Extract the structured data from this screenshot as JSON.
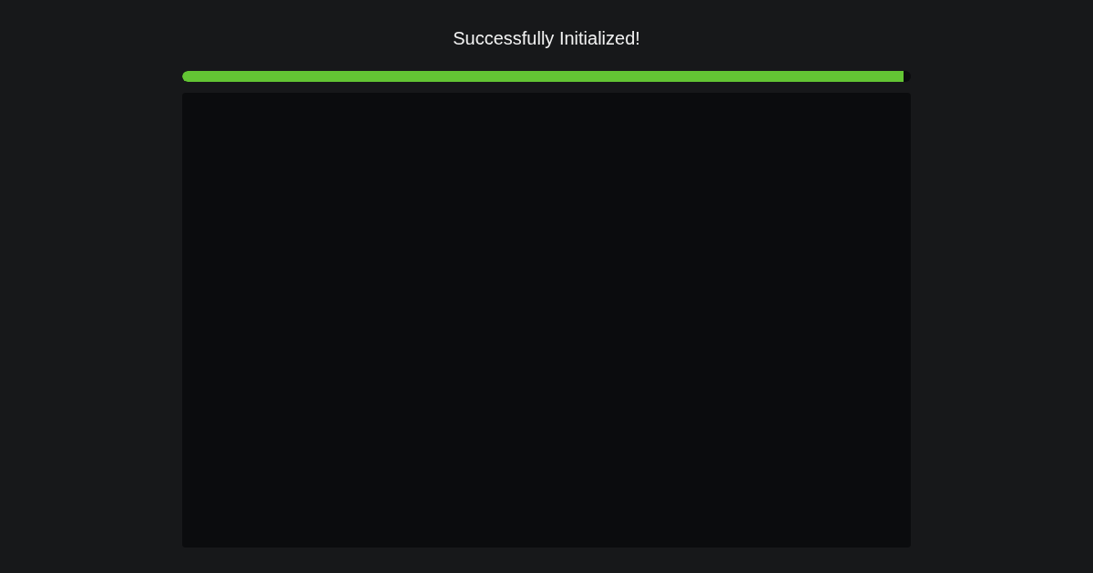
{
  "status": {
    "title": "Successfully Initialized!"
  },
  "progress": {
    "level": 0.99
  }
}
